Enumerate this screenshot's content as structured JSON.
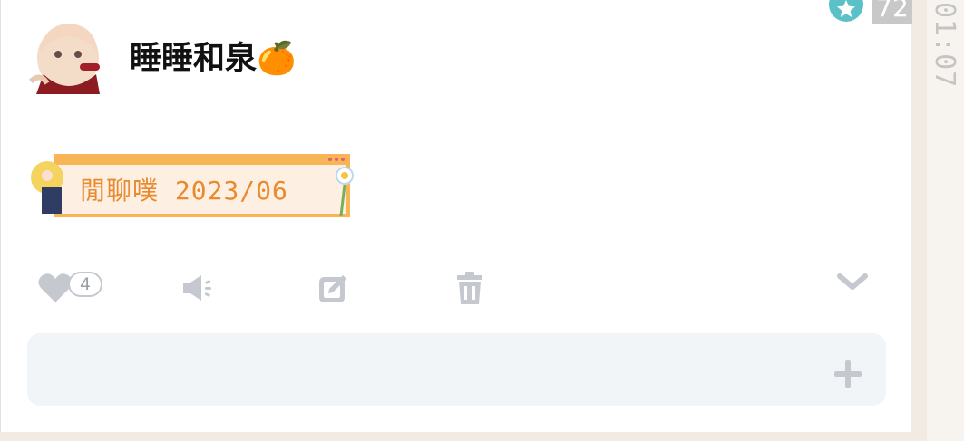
{
  "post": {
    "username": "睡睡和泉🍊",
    "sticker_text": "閒聊噗 2023/06",
    "corner_badge": "72",
    "time": "01:07"
  },
  "actions": {
    "like_count": "4"
  },
  "colors": {
    "accent_teal": "#5bc1c9",
    "icon_gray": "#c5c8cf",
    "sticker_orange": "#e98a2e",
    "comment_bg": "#f2f5f8"
  },
  "icons": [
    "avatar",
    "star-icon",
    "heart-icon",
    "speaker-icon",
    "edit-icon",
    "trash-icon",
    "chevron-down-icon",
    "plus-icon"
  ]
}
